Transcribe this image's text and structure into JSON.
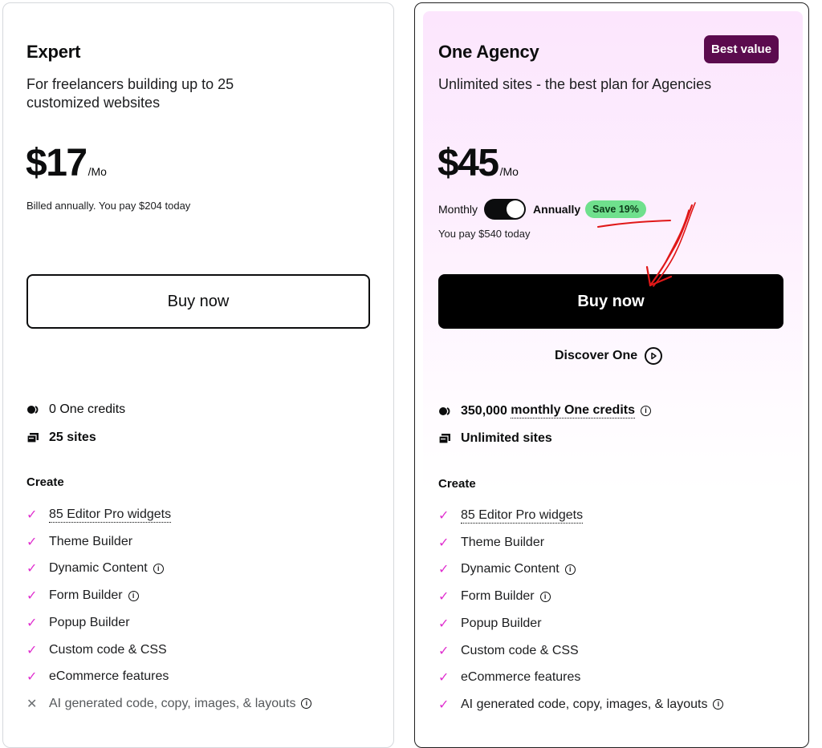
{
  "expert": {
    "title": "Expert",
    "description": "For freelancers building up to 25 customized websites",
    "price": "$17",
    "per": "/Mo",
    "billing_note": "Billed annually. You pay $204 today",
    "buy_label": "Buy now",
    "credits_label": "0 One credits",
    "sites_label": "25 sites",
    "section_title": "Create",
    "features": [
      {
        "label": "85 Editor Pro widgets",
        "included": true,
        "info": false,
        "dotted": true
      },
      {
        "label": "Theme Builder",
        "included": true,
        "info": false,
        "dotted": false
      },
      {
        "label": "Dynamic Content",
        "included": true,
        "info": true,
        "dotted": false
      },
      {
        "label": "Form Builder",
        "included": true,
        "info": true,
        "dotted": false
      },
      {
        "label": "Popup Builder",
        "included": true,
        "info": false,
        "dotted": false
      },
      {
        "label": "Custom code & CSS",
        "included": true,
        "info": false,
        "dotted": false
      },
      {
        "label": "eCommerce features",
        "included": true,
        "info": false,
        "dotted": false
      },
      {
        "label": "AI generated code, copy, images, & layouts",
        "included": false,
        "info": true,
        "dotted": false
      }
    ]
  },
  "agency": {
    "title": "One Agency",
    "badge": "Best value",
    "description": "Unlimited sites - the best plan for Agencies",
    "price": "$45",
    "per": "/Mo",
    "toggle_left": "Monthly",
    "toggle_right": "Annually",
    "save_badge": "Save 19%",
    "pay_note": "You pay $540 today",
    "buy_label": "Buy now",
    "discover_label": "Discover One",
    "credits_amount": "350,000",
    "credits_link": "monthly One credits",
    "sites_label": "Unlimited sites",
    "section_title": "Create",
    "features": [
      {
        "label": "85 Editor Pro widgets",
        "included": true,
        "info": false,
        "dotted": true
      },
      {
        "label": "Theme Builder",
        "included": true,
        "info": false,
        "dotted": false
      },
      {
        "label": "Dynamic Content",
        "included": true,
        "info": true,
        "dotted": false
      },
      {
        "label": "Form Builder",
        "included": true,
        "info": true,
        "dotted": false
      },
      {
        "label": "Popup Builder",
        "included": true,
        "info": false,
        "dotted": false
      },
      {
        "label": "Custom code & CSS",
        "included": true,
        "info": false,
        "dotted": false
      },
      {
        "label": "eCommerce features",
        "included": true,
        "info": false,
        "dotted": false
      },
      {
        "label": "AI generated code, copy, images, & layouts",
        "included": true,
        "info": true,
        "dotted": false
      }
    ]
  },
  "colors": {
    "check": "#e02fcf",
    "badge_best": "#5b0b4e",
    "save_badge": "#6fe08d",
    "annotation": "#e01818"
  },
  "icons": {
    "check": "check-icon",
    "cross": "cross-icon",
    "info": "info-icon",
    "credits": "credits-icon",
    "sites": "sites-icon",
    "play": "play-circle-icon"
  }
}
